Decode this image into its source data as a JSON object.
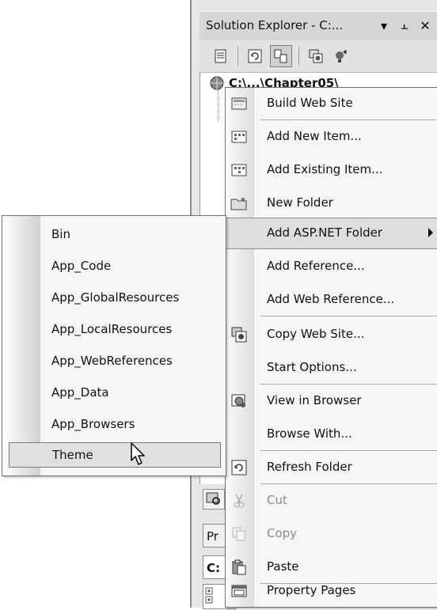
{
  "solution_explorer": {
    "title": "Solution Explorer - C:...",
    "pin_glyph": "▾",
    "autohide_glyph": "⫠",
    "close_glyph": "✕",
    "root_node": "C:\\...\\Chapter05\\",
    "toolbar_icons": [
      "properties-icon",
      "refresh-icon",
      "nest-related-files-icon",
      "copy-web-site-icon",
      "asp-net-configuration-icon"
    ]
  },
  "bottom_panel": {
    "properties_tab": "Pr",
    "object_label": "C:"
  },
  "context_menu": {
    "items": [
      {
        "label": "Build Web Site",
        "icon": "build-icon"
      },
      {
        "label": "Add New Item...",
        "icon": "add-new-item-icon"
      },
      {
        "label": "Add Existing Item...",
        "icon": "add-existing-item-icon"
      },
      {
        "label": "New Folder",
        "icon": "new-folder-icon"
      },
      {
        "label": "Add ASP.NET Folder",
        "icon": "",
        "submenu": true,
        "highlighted": true
      },
      {
        "label": "Add Reference...",
        "icon": ""
      },
      {
        "label": "Add Web Reference...",
        "icon": ""
      },
      {
        "label": "Copy Web Site...",
        "icon": "copy-web-site-icon"
      },
      {
        "label": "Start Options...",
        "icon": ""
      },
      {
        "label": "View in Browser",
        "icon": "view-in-browser-icon"
      },
      {
        "label": "Browse With...",
        "icon": ""
      },
      {
        "label": "Refresh Folder",
        "icon": "refresh-icon"
      },
      {
        "label": "Cut",
        "icon": "cut-icon",
        "disabled": true
      },
      {
        "label": "Copy",
        "icon": "copy-icon",
        "disabled": true
      },
      {
        "label": "Paste",
        "icon": "paste-icon"
      },
      {
        "label": "Property Pages",
        "icon": "property-pages-icon"
      }
    ]
  },
  "submenu": {
    "items": [
      {
        "label": "Bin"
      },
      {
        "label": "App_Code"
      },
      {
        "label": "App_GlobalResources"
      },
      {
        "label": "App_LocalResources"
      },
      {
        "label": "App_WebReferences"
      },
      {
        "label": "App_Data"
      },
      {
        "label": "App_Browsers"
      },
      {
        "label": "Theme",
        "highlighted": true
      }
    ]
  }
}
